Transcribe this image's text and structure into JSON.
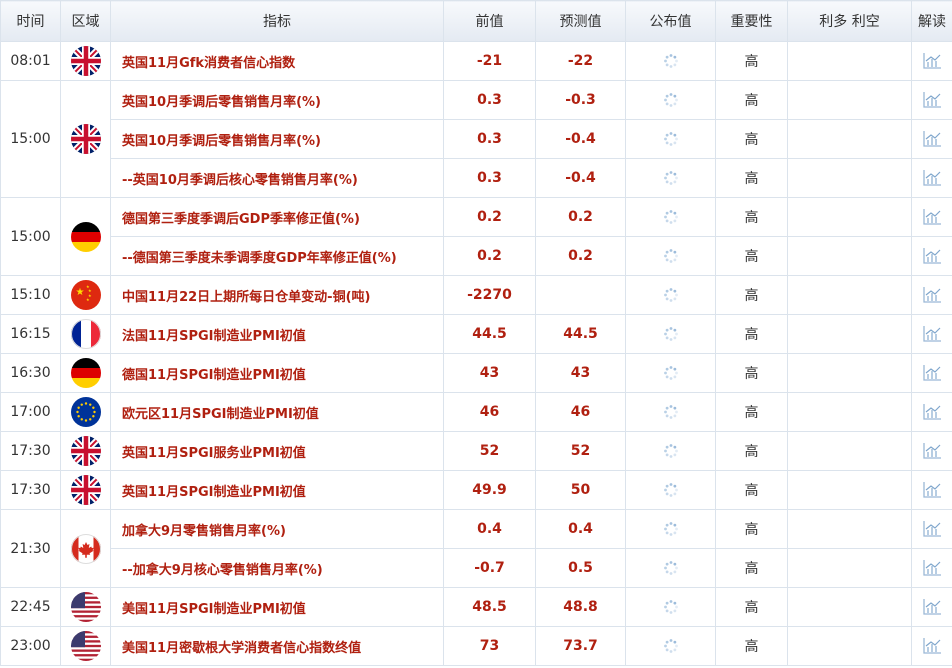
{
  "headers": {
    "time": "时间",
    "region": "区域",
    "indicator": "指标",
    "previous": "前值",
    "forecast": "预测值",
    "actual": "公布值",
    "importance": "重要性",
    "impact": "利多 利空",
    "analysis": "解读"
  },
  "groups": [
    {
      "time": "08:01",
      "flag": "uk-flag-icon",
      "rows": [
        {
          "name": "英国11月Gfk消费者信心指数",
          "previous": "-21",
          "forecast": "-22",
          "importance": "高"
        }
      ]
    },
    {
      "time": "15:00",
      "flag": "uk-flag-icon",
      "rows": [
        {
          "name": "英国10月季调后零售销售月率(%)",
          "previous": "0.3",
          "forecast": "-0.3",
          "importance": "高"
        },
        {
          "name": "英国10月季调后零售销售月率(%)",
          "previous": "0.3",
          "forecast": "-0.4",
          "importance": "高"
        },
        {
          "name": "--英国10月季调后核心零售销售月率(%)",
          "previous": "0.3",
          "forecast": "-0.4",
          "importance": "高"
        }
      ]
    },
    {
      "time": "15:00",
      "flag": "germany-flag-icon",
      "rows": [
        {
          "name": "德国第三季度季调后GDP季率修正值(%)",
          "previous": "0.2",
          "forecast": "0.2",
          "importance": "高"
        },
        {
          "name": "--德国第三季度未季调季度GDP年率修正值(%)",
          "previous": "0.2",
          "forecast": "0.2",
          "importance": "高"
        }
      ]
    },
    {
      "time": "15:10",
      "flag": "china-flag-icon",
      "rows": [
        {
          "name": "中国11月22日上期所每日仓单变动-铜(吨)",
          "previous": "-2270",
          "forecast": "",
          "importance": "高"
        }
      ]
    },
    {
      "time": "16:15",
      "flag": "france-flag-icon",
      "rows": [
        {
          "name": "法国11月SPGI制造业PMI初值",
          "previous": "44.5",
          "forecast": "44.5",
          "importance": "高"
        }
      ]
    },
    {
      "time": "16:30",
      "flag": "germany-flag-icon",
      "rows": [
        {
          "name": "德国11月SPGI制造业PMI初值",
          "previous": "43",
          "forecast": "43",
          "importance": "高"
        }
      ]
    },
    {
      "time": "17:00",
      "flag": "eu-flag-icon",
      "rows": [
        {
          "name": "欧元区11月SPGI制造业PMI初值",
          "previous": "46",
          "forecast": "46",
          "importance": "高"
        }
      ]
    },
    {
      "time": "17:30",
      "flag": "uk-flag-icon",
      "rows": [
        {
          "name": "英国11月SPGI服务业PMI初值",
          "previous": "52",
          "forecast": "52",
          "importance": "高"
        }
      ]
    },
    {
      "time": "17:30",
      "flag": "uk-flag-icon",
      "rows": [
        {
          "name": "英国11月SPGI制造业PMI初值",
          "previous": "49.9",
          "forecast": "50",
          "importance": "高"
        }
      ]
    },
    {
      "time": "21:30",
      "flag": "canada-flag-icon",
      "rows": [
        {
          "name": "加拿大9月零售销售月率(%)",
          "previous": "0.4",
          "forecast": "0.4",
          "importance": "高"
        },
        {
          "name": "--加拿大9月核心零售销售月率(%)",
          "previous": "-0.7",
          "forecast": "0.5",
          "importance": "高"
        }
      ]
    },
    {
      "time": "22:45",
      "flag": "usa-flag-icon",
      "rows": [
        {
          "name": "美国11月SPGI制造业PMI初值",
          "previous": "48.5",
          "forecast": "48.8",
          "importance": "高"
        }
      ]
    },
    {
      "time": "23:00",
      "flag": "usa-flag-icon",
      "rows": [
        {
          "name": "美国11月密歇根大学消费者信心指数终值",
          "previous": "73",
          "forecast": "73.7",
          "importance": "高"
        }
      ]
    }
  ]
}
